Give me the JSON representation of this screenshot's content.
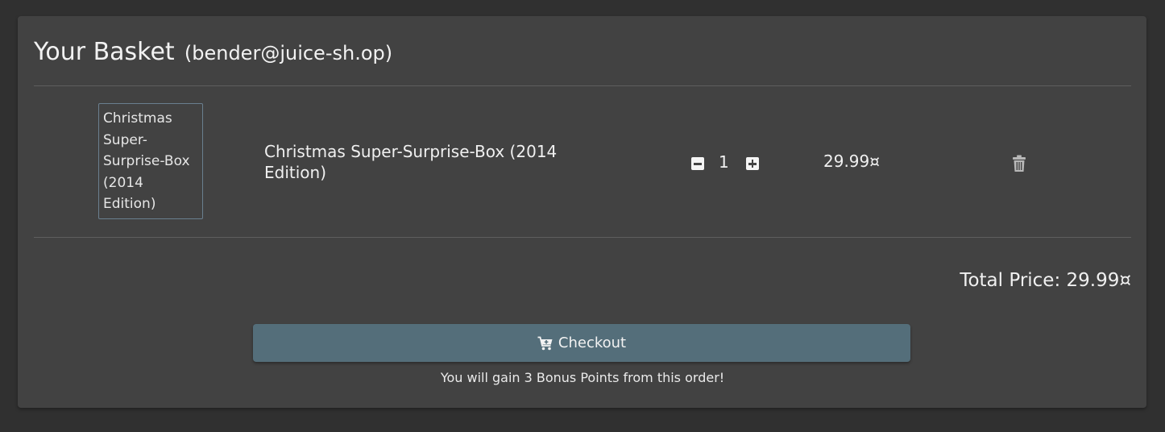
{
  "basket": {
    "title": "Your Basket",
    "email": "(bender@juice-sh.op)"
  },
  "items": [
    {
      "image_alt": "Christmas Super-Surprise-Box (2014 Edition)",
      "name": "Christmas Super-Surprise-Box (2014 Edition)",
      "quantity": "1",
      "price": "29.99¤"
    }
  ],
  "icons": {
    "decrease": "minus-square-icon",
    "increase": "plus-square-icon",
    "delete": "trash-icon",
    "checkout": "cart-icon"
  },
  "summary": {
    "total_label": "Total Price: 29.99¤"
  },
  "checkout": {
    "label": "Checkout",
    "bonus_text": "You will gain 3 Bonus Points from this order!"
  },
  "colors": {
    "background": "#303030",
    "card": "#424242",
    "button": "#546e7a"
  }
}
